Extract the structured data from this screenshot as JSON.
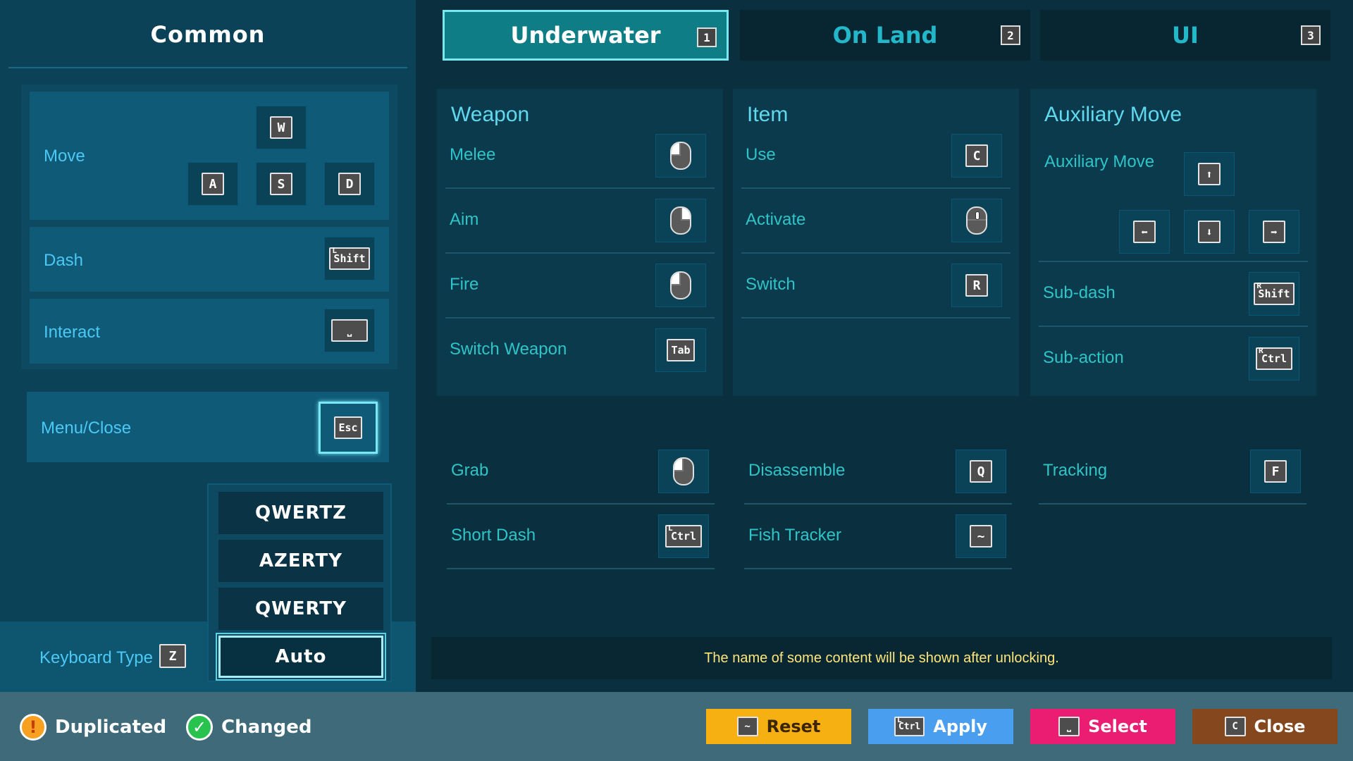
{
  "common": {
    "title": "Common",
    "move_label": "Move",
    "move_keys": [
      "W",
      "A",
      "S",
      "D"
    ],
    "dash_label": "Dash",
    "dash_key": "Shift",
    "dash_key_corner": "L",
    "interact_label": "Interact",
    "interact_key": "⎵",
    "menu_label": "Menu/Close",
    "menu_key": "Esc",
    "keyboard_type_label": "Keyboard Type",
    "keyboard_type_key": "Z",
    "keyboard_options": [
      "QWERTZ",
      "AZERTY",
      "QWERTY",
      "Auto"
    ],
    "keyboard_selected": "Auto"
  },
  "tabs": [
    {
      "label": "Underwater",
      "num": "1",
      "active": true
    },
    {
      "label": "On Land",
      "num": "2",
      "active": false
    },
    {
      "label": "UI",
      "num": "3",
      "active": false
    }
  ],
  "weapon": {
    "title": "Weapon",
    "binds": [
      {
        "label": "Melee",
        "icon": "mouse-left-icon"
      },
      {
        "label": "Aim",
        "icon": "mouse-right-icon"
      },
      {
        "label": "Fire",
        "icon": "mouse-left-icon"
      },
      {
        "label": "Switch Weapon",
        "key": "Tab"
      }
    ]
  },
  "item": {
    "title": "Item",
    "binds": [
      {
        "label": "Use",
        "key": "C"
      },
      {
        "label": "Activate",
        "icon": "mouse-wheel-icon"
      },
      {
        "label": "Switch",
        "key": "R"
      }
    ]
  },
  "auxiliary": {
    "title": "Auxiliary Move",
    "move_label": "Auxiliary Move",
    "arrows": [
      "⬆",
      "⬅",
      "⬇",
      "➡"
    ],
    "binds": [
      {
        "label": "Sub-dash",
        "key": "Shift",
        "corner": "R"
      },
      {
        "label": "Sub-action",
        "key": "Ctrl",
        "corner": "R"
      }
    ]
  },
  "lower": {
    "col1": [
      {
        "label": "Grab",
        "icon": "mouse-left-icon"
      },
      {
        "label": "Short Dash",
        "key": "Ctrl",
        "corner": "L"
      }
    ],
    "col2": [
      {
        "label": "Disassemble",
        "key": "Q"
      },
      {
        "label": "Fish Tracker",
        "key": "~"
      }
    ],
    "col3": [
      {
        "label": "Tracking",
        "key": "F"
      }
    ]
  },
  "notice": "The name of some content will be shown after unlocking.",
  "legend": {
    "duplicated": "Duplicated",
    "changed": "Changed",
    "warn_glyph": "!",
    "check_glyph": "✓"
  },
  "buttons": {
    "reset": {
      "label": "Reset",
      "key": "~"
    },
    "apply": {
      "label": "Apply",
      "key": "Ctrl",
      "corner": "L"
    },
    "select": {
      "label": "Select",
      "key": "⎵"
    },
    "close": {
      "label": "Close",
      "key": "C"
    }
  },
  "colors": {
    "reset": "#f6b012",
    "apply": "#4a9ef0",
    "select": "#eb1d72",
    "close": "#85471e",
    "active_tab": "#0f7d86",
    "notice_text": "#ffe67a"
  }
}
